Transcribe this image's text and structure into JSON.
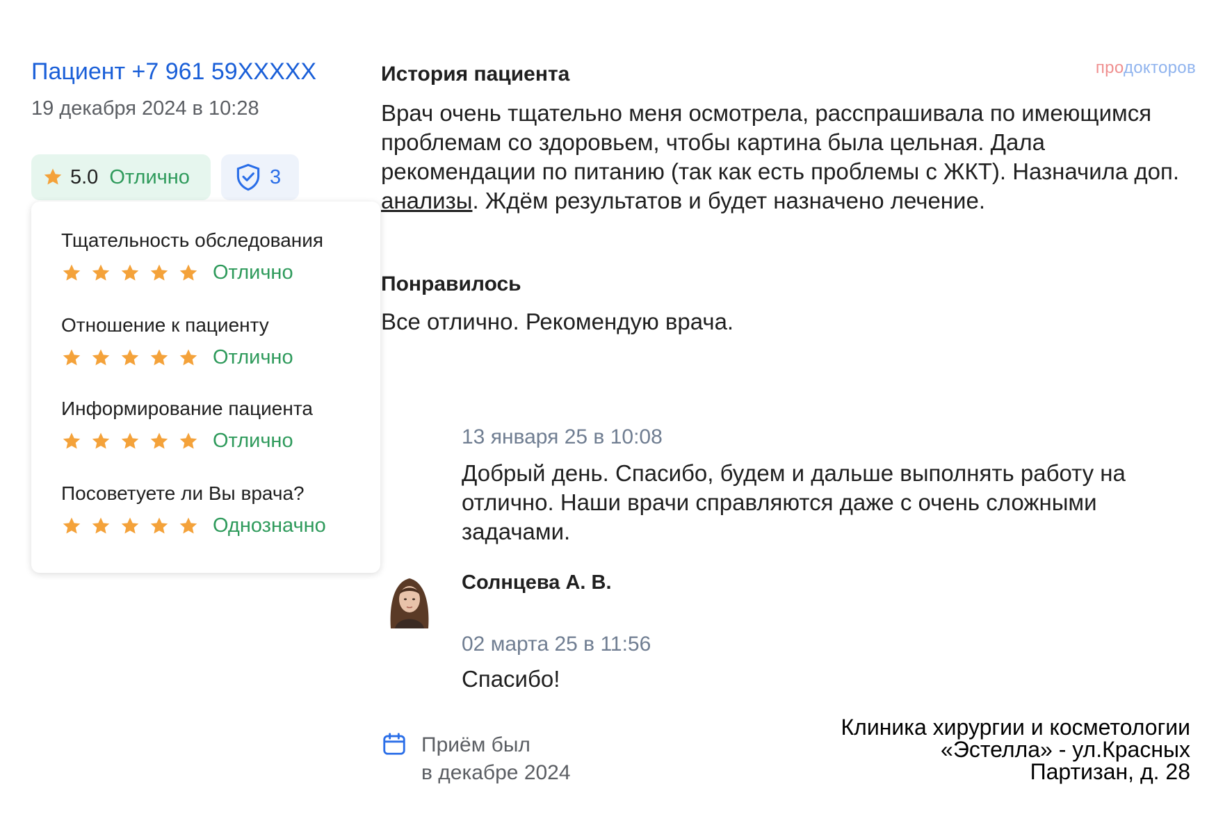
{
  "review": {
    "author": "Пациент +7 961 59XXXXX",
    "date": "19 декабря 2024 в 10:28",
    "rating_score": "5.0",
    "rating_label": "Отлично",
    "trust_count": "3"
  },
  "criteria": [
    {
      "title": "Тщательность обследования",
      "stars": 5,
      "value": "Отлично"
    },
    {
      "title": "Отношение к пациенту",
      "stars": 5,
      "value": "Отлично"
    },
    {
      "title": "Информирование пациента",
      "stars": 5,
      "value": "Отлично"
    },
    {
      "title": "Посоветуете ли Вы врача?",
      "stars": 5,
      "value": "Однозначно"
    }
  ],
  "history": {
    "heading": "История пациента",
    "text_before_link": "Врач очень тщательно меня осмотрела, расспрашивала по имеющимся проблемам со здоровьем, чтобы картина была цельная. Дала рекомендации по питанию (так как есть проблемы с ЖКТ). Назначила доп. ",
    "link": "анализы",
    "text_after_link": ". Ждём результатов и будет назначено лечение."
  },
  "liked": {
    "heading": "Понравилось",
    "text": "Все отлично. Рекомендую врача."
  },
  "brand": {
    "part1": "про",
    "part2": "докторов"
  },
  "reply": {
    "date": "13 января 25 в 10:08",
    "text": "Добрый день. Спасибо, будем и дальше выполнять работу на отлично. Наши врачи справляются даже с очень сложными задачами."
  },
  "doctor": {
    "name": "Солнцева А. В."
  },
  "reply2": {
    "date": "02 марта 25 в 11:56",
    "text": "Спасибо!"
  },
  "appointment": {
    "line1": "Приём был",
    "line2": "в декабре 2024"
  },
  "caption": {
    "line1": "Клиника хирургии и косметологии",
    "line2": "«Эстелла» - ул.Красных",
    "line3": "Партизан, д. 28"
  },
  "colors": {
    "link_blue": "#1a5fd8",
    "green": "#2e9a5b",
    "star_orange": "#f4a23a",
    "date_gray": "#6f7d91"
  },
  "icons": [
    "star-icon",
    "shield-check-icon",
    "calendar-icon"
  ]
}
